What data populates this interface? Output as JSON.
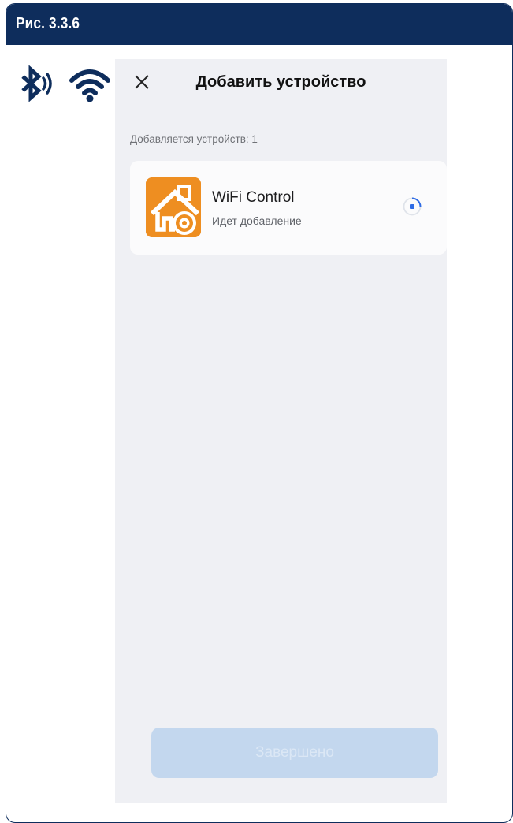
{
  "figure": {
    "label": "Рис. 3.3.6",
    "header_color": "#0e2d5c"
  },
  "connectivity": {
    "icons": [
      "bluetooth-icon",
      "wifi-icon"
    ],
    "color": "#0e2d5c"
  },
  "screen": {
    "title": "Добавить устройство",
    "close_icon": "close-icon",
    "count_label": "Добавляется устройств: 1",
    "device": {
      "name": "WiFi Control",
      "status": "Идет добавление",
      "icon": "home-gear-icon",
      "icon_color": "#ee8e21",
      "progress_icon": "spinner-icon",
      "accent_color": "#2f6ce5"
    },
    "done_button": {
      "label": "Завершено",
      "enabled": false,
      "color": "#c3d7ee"
    }
  }
}
